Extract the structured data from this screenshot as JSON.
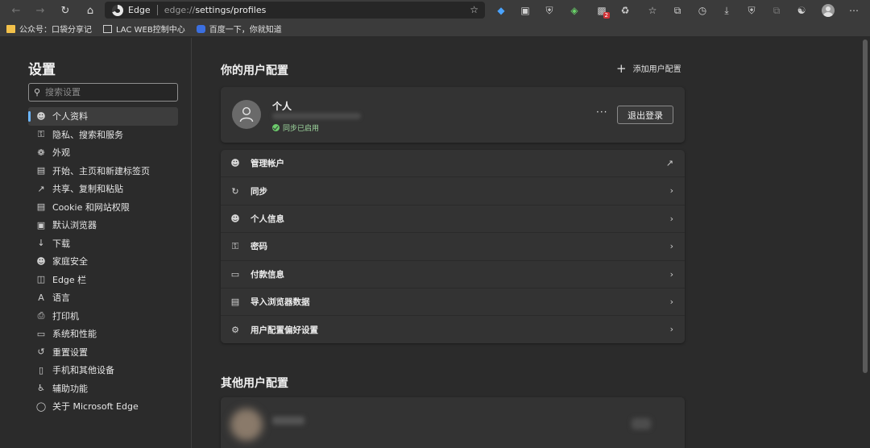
{
  "toolbar": {
    "site_name": "Edge",
    "url_prefix": "edge://",
    "url_path": "settings/profiles"
  },
  "bookmarks": [
    {
      "label": "公众号：口袋分享记",
      "icon": "folder-icon"
    },
    {
      "label": "LAC WEB控制中心",
      "icon": "page-icon"
    },
    {
      "label": "百度一下，你就知道",
      "icon": "baidu-icon"
    }
  ],
  "sidebar": {
    "title": "设置",
    "search_placeholder": "搜索设置",
    "items": [
      {
        "label": "个人资料",
        "icon": "profile-icon",
        "active": true
      },
      {
        "label": "隐私、搜索和服务",
        "icon": "lock-icon"
      },
      {
        "label": "外观",
        "icon": "palette-icon"
      },
      {
        "label": "开始、主页和新建标签页",
        "icon": "home-icon"
      },
      {
        "label": "共享、复制和粘贴",
        "icon": "share-icon"
      },
      {
        "label": "Cookie 和网站权限",
        "icon": "cookie-icon"
      },
      {
        "label": "默认浏览器",
        "icon": "browser-icon"
      },
      {
        "label": "下载",
        "icon": "download-icon"
      },
      {
        "label": "家庭安全",
        "icon": "family-icon"
      },
      {
        "label": "Edge 栏",
        "icon": "edge-bar-icon"
      },
      {
        "label": "语言",
        "icon": "language-icon"
      },
      {
        "label": "打印机",
        "icon": "printer-icon"
      },
      {
        "label": "系统和性能",
        "icon": "laptop-icon"
      },
      {
        "label": "重置设置",
        "icon": "reset-icon"
      },
      {
        "label": "手机和其他设备",
        "icon": "phone-icon"
      },
      {
        "label": "辅助功能",
        "icon": "accessibility-icon"
      },
      {
        "label": "关于 Microsoft Edge",
        "icon": "edge-icon"
      }
    ]
  },
  "main": {
    "title": "你的用户配置",
    "add_profile": "添加用户配置",
    "profile": {
      "name": "个人",
      "sync_status": "同步已启用",
      "more": "···",
      "logout": "退出登录"
    },
    "rows": [
      {
        "label": "管理帐户",
        "icon": "account-icon",
        "action": "external"
      },
      {
        "label": "同步",
        "icon": "sync-icon",
        "action": "chevron"
      },
      {
        "label": "个人信息",
        "icon": "id-card-icon",
        "action": "chevron"
      },
      {
        "label": "密码",
        "icon": "key-icon",
        "action": "chevron"
      },
      {
        "label": "付款信息",
        "icon": "card-icon",
        "action": "chevron"
      },
      {
        "label": "导入浏览器数据",
        "icon": "import-icon",
        "action": "chevron"
      },
      {
        "label": "用户配置偏好设置",
        "icon": "profile-prefs-icon",
        "action": "chevron"
      }
    ],
    "other_title": "其他用户配置"
  }
}
